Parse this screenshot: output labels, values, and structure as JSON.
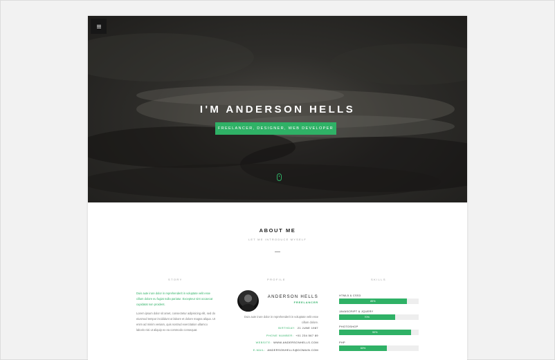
{
  "hero": {
    "menu_icon": "hamburger-icon",
    "title": "I'M ANDERSON HELLS",
    "subtitle": "FREELANCER, DESIGNER, WEB DEVELOPER",
    "scroll_icon": "mouse-icon",
    "accent_color": "#2fb166"
  },
  "about": {
    "title": "ABOUT ME",
    "subtitle": "LET ME INTRODUCE MYSELF"
  },
  "columns": {
    "story": "STORY",
    "profile": "PROFILE",
    "skills": "SKILLS"
  },
  "story": {
    "highlight": "Duis aute irure dolor in reprehenderit in voluptate velit esse cillum dolore eu fugiat nulla pariatur. Excepteur sint occaecat cupidatat non proident.",
    "body": "Lorem ipsum dolor sit amet, consectetur adipisicing elit, sed do eiusmod tempor incididunt ut labore et dolore magna aliqua. Ut enim ad minim veniam, quis nostrud exercitation ullamco laboris nisi ut aliquip ex ea commodo consequat."
  },
  "profile": {
    "name": "ANDERSON HELLS",
    "role": "FREELANCER",
    "description": "Duis aute irure dolor in reprehenderit in voluptate velit esse cillum dolore.",
    "info": [
      {
        "key": "BIRTHDAY:",
        "value": "21 JUNE 1987"
      },
      {
        "key": "PHONE NUMBER:",
        "value": "+01 234 567 89"
      },
      {
        "key": "WEBSITE:",
        "value": "WWW.ANDERSONHELLS.COM"
      },
      {
        "key": "E-MAIL:",
        "value": "ANDERSONHELLS@DOMAIN.COM"
      }
    ]
  },
  "skills": [
    {
      "name": "HTML5 & CSS3",
      "percent": 85,
      "label": "85%"
    },
    {
      "name": "JAVASCRIPT & JQUERY",
      "percent": 70,
      "label": "70%"
    },
    {
      "name": "PHOTOSHOP",
      "percent": 90,
      "label": "90%"
    },
    {
      "name": "PHP",
      "percent": 60,
      "label": "60%"
    }
  ]
}
